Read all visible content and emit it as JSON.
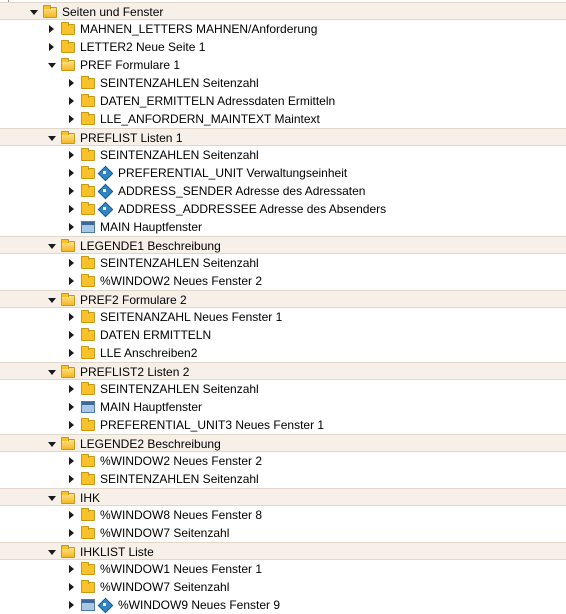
{
  "tree": [
    {
      "level": 0,
      "state": "open",
      "icon": "folder-open",
      "text": "Seiten und Fenster",
      "band": true
    },
    {
      "level": 1,
      "state": "closed",
      "icon": "folder",
      "text": "MAHNEN_LETTERS MAHNEN/Anforderung"
    },
    {
      "level": 1,
      "state": "closed",
      "icon": "folder",
      "text": "LETTER2 Neue Seite 1"
    },
    {
      "level": 1,
      "state": "open",
      "icon": "folder-open",
      "text": "PREF Formulare 1"
    },
    {
      "level": 2,
      "state": "closed",
      "icon": "folder",
      "text": "SEINTENZAHLEN Seitenzahl"
    },
    {
      "level": 2,
      "state": "closed",
      "icon": "folder",
      "text": "DATEN_ERMITTELN Adressdaten Ermitteln"
    },
    {
      "level": 2,
      "state": "closed",
      "icon": "folder",
      "text": "LLE_ANFORDERN_MAINTEXT Maintext"
    },
    {
      "level": 1,
      "state": "open",
      "icon": "folder-open",
      "text": "PREFLIST Listen 1",
      "band": true
    },
    {
      "level": 2,
      "state": "closed",
      "icon": "folder",
      "text": "SEINTENZAHLEN Seitenzahl"
    },
    {
      "level": 2,
      "state": "closed",
      "icon": "folder-badge",
      "text": "PREFERENTIAL_UNIT Verwaltungseinheit"
    },
    {
      "level": 2,
      "state": "closed",
      "icon": "folder-badge",
      "text": "ADDRESS_SENDER Adresse des Adressaten"
    },
    {
      "level": 2,
      "state": "closed",
      "icon": "folder-badge",
      "text": "ADDRESS_ADDRESSEE Adresse des Absenders"
    },
    {
      "level": 2,
      "state": "closed",
      "icon": "window",
      "text": "MAIN Hauptfenster"
    },
    {
      "level": 1,
      "state": "open",
      "icon": "folder-open",
      "text": "LEGENDE1 Beschreibung",
      "band": true
    },
    {
      "level": 2,
      "state": "closed",
      "icon": "folder",
      "text": "SEINTENZAHLEN Seitenzahl"
    },
    {
      "level": 2,
      "state": "closed",
      "icon": "folder",
      "text": "%WINDOW2 Neues Fenster 2"
    },
    {
      "level": 1,
      "state": "open",
      "icon": "folder-open",
      "text": "PREF2 Formulare 2",
      "band": true
    },
    {
      "level": 2,
      "state": "closed",
      "icon": "folder",
      "text": "SEITENANZAHL Neues Fenster 1"
    },
    {
      "level": 2,
      "state": "closed",
      "icon": "folder",
      "text": "DATEN ERMITTELN"
    },
    {
      "level": 2,
      "state": "closed",
      "icon": "folder",
      "text": "LLE Anschreiben2"
    },
    {
      "level": 1,
      "state": "open",
      "icon": "folder-open",
      "text": "PREFLIST2 Listen 2",
      "band": true
    },
    {
      "level": 2,
      "state": "closed",
      "icon": "folder",
      "text": "SEINTENZAHLEN Seitenzahl"
    },
    {
      "level": 2,
      "state": "closed",
      "icon": "window",
      "text": "MAIN Hauptfenster"
    },
    {
      "level": 2,
      "state": "closed",
      "icon": "folder",
      "text": "PREFERENTIAL_UNIT3 Neues Fenster 1"
    },
    {
      "level": 1,
      "state": "open",
      "icon": "folder-open",
      "text": "LEGENDE2 Beschreibung",
      "band": true
    },
    {
      "level": 2,
      "state": "closed",
      "icon": "folder",
      "text": "%WINDOW2 Neues Fenster 2"
    },
    {
      "level": 2,
      "state": "closed",
      "icon": "folder",
      "text": "SEINTENZAHLEN Seitenzahl"
    },
    {
      "level": 1,
      "state": "open",
      "icon": "folder-open",
      "text": "IHK",
      "band": true
    },
    {
      "level": 2,
      "state": "closed",
      "icon": "folder",
      "text": "%WINDOW8 Neues Fenster 8"
    },
    {
      "level": 2,
      "state": "closed",
      "icon": "folder",
      "text": "%WINDOW7 Seitenzahl"
    },
    {
      "level": 1,
      "state": "open",
      "icon": "folder-open",
      "text": "IHKLIST Liste",
      "band": true
    },
    {
      "level": 2,
      "state": "closed",
      "icon": "folder",
      "text": "%WINDOW1 Neues Fenster 1"
    },
    {
      "level": 2,
      "state": "closed",
      "icon": "folder",
      "text": "%WINDOW7 Seitenzahl"
    },
    {
      "level": 2,
      "state": "closed",
      "icon": "window-badge",
      "text": "%WINDOW9 Neues Fenster 9"
    }
  ],
  "colors": {
    "band": "#f7f0e9",
    "folder": "#f9c22b",
    "window": "#a8c8e6",
    "badge": "#2f86c7"
  }
}
